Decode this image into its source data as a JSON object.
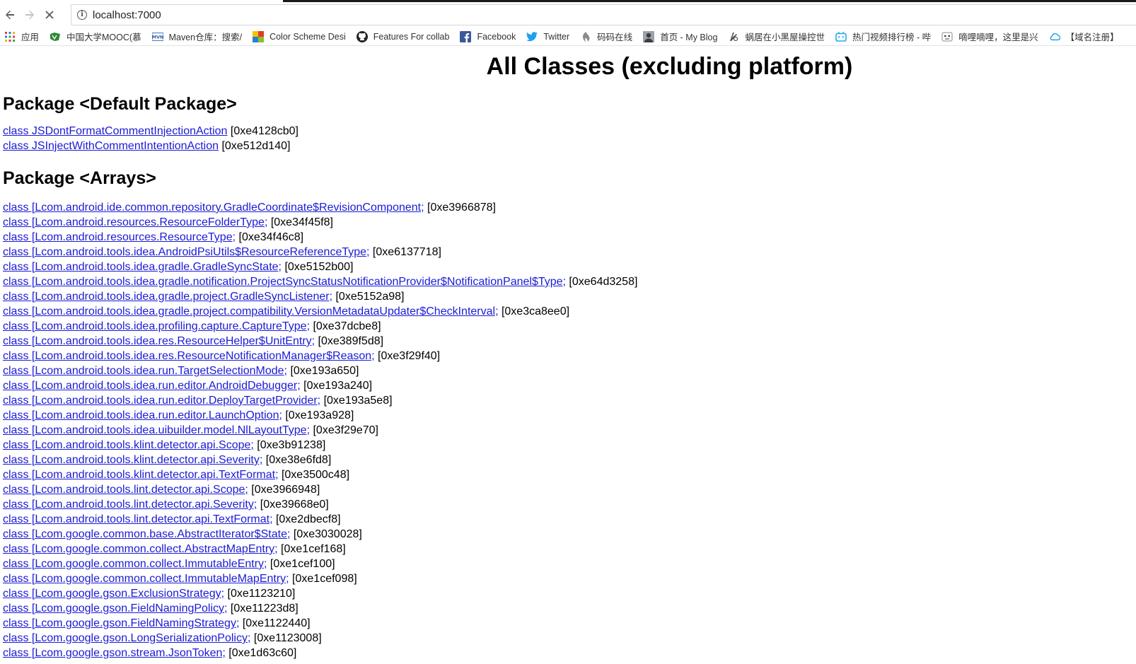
{
  "browser": {
    "url": "localhost:7000",
    "bookmarks": [
      {
        "label": "应用",
        "icon": "apps-grid-icon"
      },
      {
        "label": "中国大学MOOC(慕",
        "icon": "mooc-icon"
      },
      {
        "label": "Maven仓库：搜索/",
        "icon": "mvn-icon"
      },
      {
        "label": "Color Scheme Desi",
        "icon": "color-scheme-icon"
      },
      {
        "label": "Features For collab",
        "icon": "github-icon"
      },
      {
        "label": "Facebook",
        "icon": "facebook-icon"
      },
      {
        "label": "Twitter",
        "icon": "twitter-icon"
      },
      {
        "label": "码码在线",
        "icon": "mama-icon"
      },
      {
        "label": "首页 - My Blog",
        "icon": "blog-avatar-icon"
      },
      {
        "label": "蜗居在小黑屋操控世",
        "icon": "snail-icon"
      },
      {
        "label": "热门视频排行榜 - 哔",
        "icon": "bilibili-icon"
      },
      {
        "label": "嘀哩嘀哩，这里是兴",
        "icon": "dilidili-icon"
      },
      {
        "label": "【域名注册】",
        "icon": "cloud-icon"
      }
    ]
  },
  "page": {
    "title": "All Classes (excluding platform)",
    "packages": [
      {
        "heading": "Package <Default Package>",
        "classes": [
          {
            "name": "class JSDontFormatCommentInjectionAction",
            "addr": " [0xe4128cb0]"
          },
          {
            "name": "class JSInjectWithCommentIntentionAction",
            "addr": " [0xe512d140]"
          }
        ]
      },
      {
        "heading": "Package <Arrays>",
        "classes": [
          {
            "name": "class [Lcom.android.ide.common.repository.GradleCoordinate$RevisionComponent;",
            "addr": " [0xe3966878]"
          },
          {
            "name": "class [Lcom.android.resources.ResourceFolderType;",
            "addr": " [0xe34f45f8]"
          },
          {
            "name": "class [Lcom.android.resources.ResourceType;",
            "addr": " [0xe34f46c8]"
          },
          {
            "name": "class [Lcom.android.tools.idea.AndroidPsiUtils$ResourceReferenceType;",
            "addr": " [0xe6137718]"
          },
          {
            "name": "class [Lcom.android.tools.idea.gradle.GradleSyncState;",
            "addr": " [0xe5152b00]"
          },
          {
            "name": "class [Lcom.android.tools.idea.gradle.notification.ProjectSyncStatusNotificationProvider$NotificationPanel$Type;",
            "addr": " [0xe64d3258]"
          },
          {
            "name": "class [Lcom.android.tools.idea.gradle.project.GradleSyncListener;",
            "addr": " [0xe5152a98]"
          },
          {
            "name": "class [Lcom.android.tools.idea.gradle.project.compatibility.VersionMetadataUpdater$CheckInterval;",
            "addr": " [0xe3ca8ee0]"
          },
          {
            "name": "class [Lcom.android.tools.idea.profiling.capture.CaptureType;",
            "addr": " [0xe37dcbe8]"
          },
          {
            "name": "class [Lcom.android.tools.idea.res.ResourceHelper$UnitEntry;",
            "addr": " [0xe389f5d8]"
          },
          {
            "name": "class [Lcom.android.tools.idea.res.ResourceNotificationManager$Reason;",
            "addr": " [0xe3f29f40]"
          },
          {
            "name": "class [Lcom.android.tools.idea.run.TargetSelectionMode;",
            "addr": " [0xe193a650]"
          },
          {
            "name": "class [Lcom.android.tools.idea.run.editor.AndroidDebugger;",
            "addr": " [0xe193a240]"
          },
          {
            "name": "class [Lcom.android.tools.idea.run.editor.DeployTargetProvider;",
            "addr": " [0xe193a5e8]"
          },
          {
            "name": "class [Lcom.android.tools.idea.run.editor.LaunchOption;",
            "addr": " [0xe193a928]"
          },
          {
            "name": "class [Lcom.android.tools.idea.uibuilder.model.NlLayoutType;",
            "addr": " [0xe3f29e70]"
          },
          {
            "name": "class [Lcom.android.tools.klint.detector.api.Scope;",
            "addr": " [0xe3b91238]"
          },
          {
            "name": "class [Lcom.android.tools.klint.detector.api.Severity;",
            "addr": " [0xe38e6fd8]"
          },
          {
            "name": "class [Lcom.android.tools.klint.detector.api.TextFormat;",
            "addr": " [0xe3500c48]"
          },
          {
            "name": "class [Lcom.android.tools.lint.detector.api.Scope;",
            "addr": " [0xe3966948]"
          },
          {
            "name": "class [Lcom.android.tools.lint.detector.api.Severity;",
            "addr": " [0xe39668e0]"
          },
          {
            "name": "class [Lcom.android.tools.lint.detector.api.TextFormat;",
            "addr": " [0xe2dbecf8]"
          },
          {
            "name": "class [Lcom.google.common.base.AbstractIterator$State;",
            "addr": " [0xe3030028]"
          },
          {
            "name": "class [Lcom.google.common.collect.AbstractMapEntry;",
            "addr": " [0xe1cef168]"
          },
          {
            "name": "class [Lcom.google.common.collect.ImmutableEntry;",
            "addr": " [0xe1cef100]"
          },
          {
            "name": "class [Lcom.google.common.collect.ImmutableMapEntry;",
            "addr": " [0xe1cef098]"
          },
          {
            "name": "class [Lcom.google.gson.ExclusionStrategy;",
            "addr": " [0xe1123210]"
          },
          {
            "name": "class [Lcom.google.gson.FieldNamingPolicy;",
            "addr": " [0xe11223d8]"
          },
          {
            "name": "class [Lcom.google.gson.FieldNamingStrategy;",
            "addr": " [0xe1122440]"
          },
          {
            "name": "class [Lcom.google.gson.LongSerializationPolicy;",
            "addr": " [0xe1123008]"
          },
          {
            "name": "class [Lcom.google.gson.stream.JsonToken;",
            "addr": " [0xe1d63c60]"
          }
        ]
      }
    ]
  },
  "colors": {
    "link": "#1b1bd6",
    "text": "#000000"
  }
}
